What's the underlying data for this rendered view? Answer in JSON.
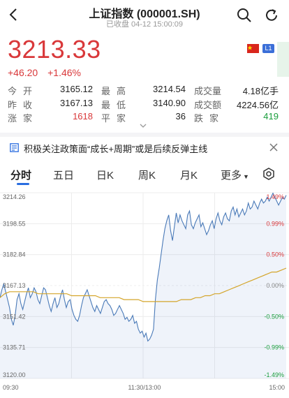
{
  "header": {
    "title": "上证指数 (000001.SH)",
    "subtitle": "已收盘  04-12 15:00:09",
    "icons": [
      "back-icon",
      "search-icon",
      "refresh-icon"
    ]
  },
  "quote": {
    "price": "3213.33",
    "change": "+46.20",
    "change_pct": "+1.46%",
    "badge_l1": "L1",
    "colors": {
      "up": "#d9383a",
      "down": "#1a9e3c",
      "accent": "#2a6de0"
    }
  },
  "stats": [
    [
      {
        "label": "今开",
        "value": "3165.12",
        "color": "dark"
      },
      {
        "label": "最高",
        "value": "3214.54",
        "color": "dark"
      },
      {
        "label": "成交量",
        "value": "4.18亿手",
        "color": "dark"
      }
    ],
    [
      {
        "label": "昨收",
        "value": "3167.13",
        "color": "dark"
      },
      {
        "label": "最低",
        "value": "3140.90",
        "color": "dark"
      },
      {
        "label": "成交额",
        "value": "4224.56亿",
        "color": "dark"
      }
    ],
    [
      {
        "label": "涨家",
        "value": "1618",
        "color": "red"
      },
      {
        "label": "平家",
        "value": "36",
        "color": "dark"
      },
      {
        "label": "跌家",
        "value": "419",
        "color": "green"
      }
    ]
  ],
  "news": {
    "text": "积极关注政策面“成长+周期”或是后续反弹主线"
  },
  "tabs": [
    "分时",
    "五日",
    "日K",
    "周K",
    "月K",
    "更多"
  ],
  "chart_data": {
    "type": "line",
    "yticks": [
      "3214.26",
      "3198.55",
      "3182.84",
      "3167.13",
      "3151.42",
      "3135.71",
      "3120.00"
    ],
    "pct_ticks": [
      "1.49%",
      "0.99%",
      "0.50%",
      "0.00%",
      "-0.50%",
      "-0.99%",
      "-1.49%"
    ],
    "xticks": [
      "09:30",
      "11:30/13:00",
      "15:00"
    ],
    "ylim": [
      3120.0,
      3214.26
    ],
    "prev_close": 3167.13,
    "series": [
      {
        "name": "",
        "color": "#4a7ab8",
        "values": [
          3161,
          3165,
          3168,
          3164,
          3160,
          3156,
          3150,
          3147,
          3152,
          3160,
          3163,
          3158,
          3155,
          3159,
          3163,
          3166,
          3161,
          3163,
          3166,
          3164,
          3160,
          3158,
          3162,
          3166,
          3165,
          3161,
          3157,
          3154,
          3158,
          3161,
          3156,
          3158,
          3162,
          3165,
          3160,
          3156,
          3159,
          3160,
          3155,
          3152,
          3150,
          3149,
          3152,
          3157,
          3161,
          3163,
          3165,
          3162,
          3159,
          3156,
          3154,
          3157,
          3155,
          3153,
          3156,
          3159,
          3160,
          3158,
          3157,
          3155,
          3152,
          3153,
          3155,
          3157,
          3155,
          3153,
          3150,
          3151,
          3149,
          3150,
          3152,
          3148,
          3149,
          3145,
          3143,
          3144,
          3141,
          3143,
          3139,
          3140,
          3142,
          3145,
          3160,
          3170,
          3176,
          3183,
          3190,
          3196,
          3200,
          3203,
          3195,
          3190,
          3197,
          3204,
          3199,
          3203,
          3200,
          3198,
          3196,
          3203,
          3205,
          3198,
          3196,
          3199,
          3201,
          3203,
          3197,
          3199,
          3196,
          3193,
          3195,
          3198,
          3200,
          3196,
          3201,
          3204,
          3200,
          3198,
          3202,
          3204,
          3201,
          3200,
          3205,
          3207,
          3203,
          3206,
          3202,
          3204,
          3206,
          3203,
          3205,
          3209,
          3206,
          3207,
          3210,
          3208,
          3206,
          3209,
          3211,
          3209,
          3210,
          3212,
          3210,
          3212,
          3214,
          3212,
          3210,
          3208,
          3210,
          3212,
          3211,
          3213
        ]
      },
      {
        "name": "",
        "color": "#d4a52a",
        "values": [
          3161,
          3163,
          3164,
          3164,
          3164,
          3164,
          3164,
          3164,
          3163,
          3163,
          3163,
          3163,
          3163,
          3163,
          3163,
          3162,
          3162,
          3162,
          3162,
          3162,
          3162,
          3161,
          3161,
          3161,
          3161,
          3161,
          3160,
          3160,
          3160,
          3160,
          3159,
          3159,
          3159,
          3159,
          3159,
          3159,
          3159,
          3159,
          3160,
          3160,
          3160,
          3161,
          3161,
          3162,
          3162,
          3163,
          3163,
          3164,
          3165,
          3166,
          3167,
          3168,
          3169,
          3170,
          3171,
          3172,
          3173,
          3174,
          3174,
          3175,
          3176
        ]
      }
    ]
  }
}
